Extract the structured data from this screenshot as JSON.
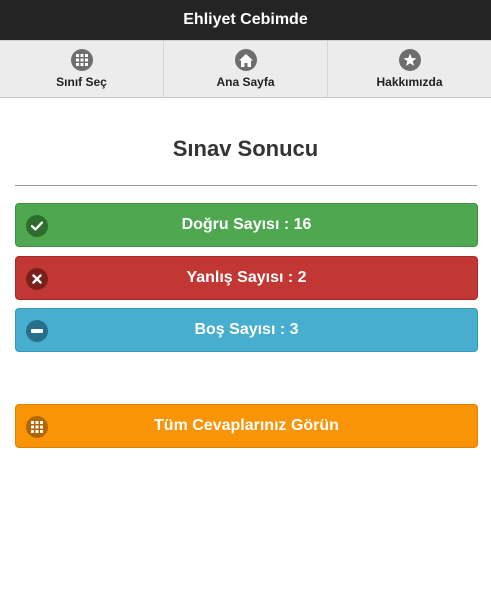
{
  "header": {
    "title": "Ehliyet Cebimde"
  },
  "nav": [
    {
      "label": "Sınıf Seç",
      "icon": "grid-icon"
    },
    {
      "label": "Ana Sayfa",
      "icon": "home-icon"
    },
    {
      "label": "Hakkımızda",
      "icon": "star-icon"
    }
  ],
  "main": {
    "title": "Sınav Sonucu",
    "results": {
      "correct": "Doğru Sayısı : 16",
      "wrong": "Yanlış Sayısı : 2",
      "empty": "Boş Sayısı : 3"
    },
    "answers_button": "Tüm Cevaplarınız Görün"
  },
  "colors": {
    "header": "#242424",
    "correct": "#4fa750",
    "wrong": "#c23733",
    "empty": "#47aed0",
    "answers": "#f89406"
  }
}
